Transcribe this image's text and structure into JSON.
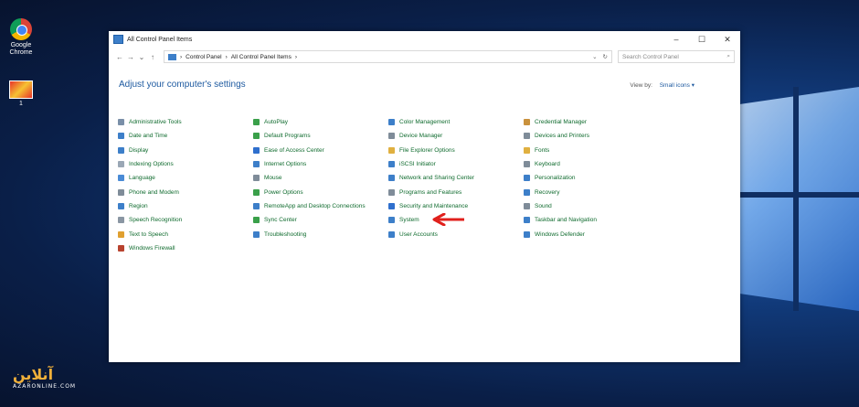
{
  "desktop": {
    "icons": [
      {
        "label_line1": "Google",
        "label_line2": "Chrome"
      },
      {
        "label_line1": "1",
        "label_line2": ""
      }
    ]
  },
  "window": {
    "title": "All Control Panel Items",
    "controls": {
      "minimize": "–",
      "maximize": "☐",
      "close": "✕"
    },
    "nav": {
      "back": "←",
      "forward": "→",
      "down": "⌄",
      "up": "↑"
    },
    "breadcrumb": [
      "Control Panel",
      "All Control Panel Items"
    ],
    "breadcrumb_sep": "›",
    "address_tail": {
      "dropdown": "⌄",
      "refresh": "↻"
    },
    "search": {
      "placeholder": "Search Control Panel",
      "icon": "⌕"
    },
    "heading": "Adjust your computer's settings",
    "view_by": {
      "label": "View by:",
      "value": "Small icons ▾"
    }
  },
  "items": [
    {
      "label": "Administrative Tools",
      "color": "#7a8fa8"
    },
    {
      "label": "Date and Time",
      "color": "#3d7fc9"
    },
    {
      "label": "Display",
      "color": "#3d7fc9"
    },
    {
      "label": "Indexing Options",
      "color": "#9aa7b5"
    },
    {
      "label": "Language",
      "color": "#4a8bd6"
    },
    {
      "label": "Phone and Modem",
      "color": "#7f8c99"
    },
    {
      "label": "Region",
      "color": "#3d7fc9"
    },
    {
      "label": "Speech Recognition",
      "color": "#8a96a3"
    },
    {
      "label": "Text to Speech",
      "color": "#e0a030"
    },
    {
      "label": "Windows Firewall",
      "color": "#b8432f"
    },
    {
      "label": "AutoPlay",
      "color": "#3aa04a"
    },
    {
      "label": "Default Programs",
      "color": "#3aa04a"
    },
    {
      "label": "Ease of Access Center",
      "color": "#2f6fcd"
    },
    {
      "label": "Internet Options",
      "color": "#3d7fc9"
    },
    {
      "label": "Mouse",
      "color": "#7f8c99"
    },
    {
      "label": "Power Options",
      "color": "#3aa04a"
    },
    {
      "label": "RemoteApp and Desktop Connections",
      "color": "#3d7fc9"
    },
    {
      "label": "Sync Center",
      "color": "#3aa04a"
    },
    {
      "label": "Troubleshooting",
      "color": "#3d7fc9"
    },
    {
      "label": "Color Management",
      "color": "#3d7fc9"
    },
    {
      "label": "Device Manager",
      "color": "#7f8c99"
    },
    {
      "label": "File Explorer Options",
      "color": "#e0b040"
    },
    {
      "label": "iSCSI Initiator",
      "color": "#3d7fc9"
    },
    {
      "label": "Network and Sharing Center",
      "color": "#3d7fc9"
    },
    {
      "label": "Programs and Features",
      "color": "#7f8c99"
    },
    {
      "label": "Security and Maintenance",
      "color": "#2f6fcd"
    },
    {
      "label": "System",
      "color": "#3d7fc9"
    },
    {
      "label": "User Accounts",
      "color": "#3d7fc9"
    },
    {
      "label": "Credential Manager",
      "color": "#c9913d"
    },
    {
      "label": "Devices and Printers",
      "color": "#7f8c99"
    },
    {
      "label": "Fonts",
      "color": "#e0b040"
    },
    {
      "label": "Keyboard",
      "color": "#7f8c99"
    },
    {
      "label": "Personalization",
      "color": "#3d7fc9"
    },
    {
      "label": "Recovery",
      "color": "#3d7fc9"
    },
    {
      "label": "Sound",
      "color": "#7f8c99"
    },
    {
      "label": "Taskbar and Navigation",
      "color": "#3d7fc9"
    },
    {
      "label": "Windows Defender",
      "color": "#3d7fc9"
    }
  ],
  "annotation": {
    "arrow_color": "#e0201c"
  },
  "watermark": {
    "text": "آنلاین",
    "sub": "AZARONLINE.COM"
  }
}
